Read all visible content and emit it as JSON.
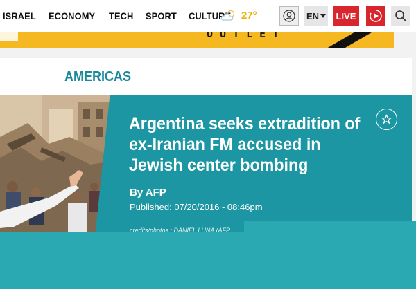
{
  "nav": {
    "items": [
      "ISRAEL",
      "ECONOMY",
      "TECH",
      "SPORT",
      "CULTURE"
    ],
    "weather": {
      "icon": "cloud-sun-icon",
      "temperature": "27°"
    },
    "lang_label": "EN",
    "live_label": "LIVE",
    "colors": {
      "live": "#d7262d",
      "weather": "#e8b000"
    }
  },
  "ad": {
    "visible_text": "OUTLET"
  },
  "section": {
    "title": "AMERICAS",
    "color": "#1a8a9a"
  },
  "article": {
    "headline": "Argentina seeks extradition of ex-Iranian FM accused in Jewish center bombing",
    "byline": "By AFP",
    "published": "Published: 07/20/2016 - 08:46pm",
    "credits": "credits/photos : DANIEL LUNA (AFP",
    "panel_color": "#1c96a2"
  }
}
